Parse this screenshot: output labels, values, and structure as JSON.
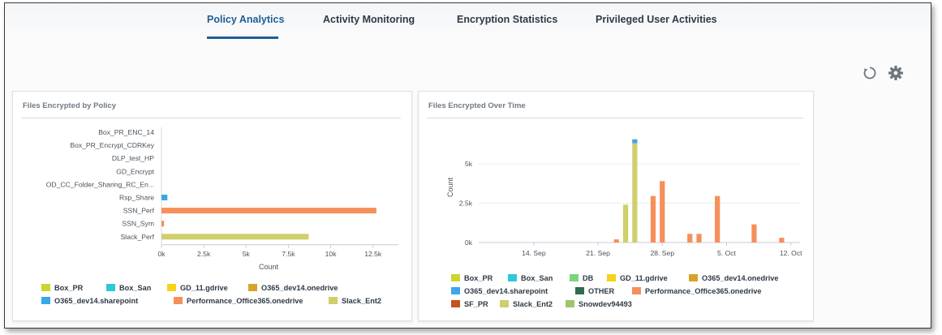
{
  "tabs": [
    {
      "label": "Policy Analytics",
      "active": true
    },
    {
      "label": "Activity Monitoring",
      "active": false
    },
    {
      "label": "Encryption Statistics",
      "active": false
    },
    {
      "label": "Privileged User Activities",
      "active": false
    }
  ],
  "toolbar": {
    "refresh_icon": "refresh-icon",
    "settings_icon": "gear-icon"
  },
  "panels": {
    "by_policy": {
      "title": "Files Encrypted by Policy"
    },
    "over_time": {
      "title": "Files Encrypted Over Time"
    }
  },
  "colors": {
    "Box_PR": "#cad62c",
    "Box_San": "#2ec8d8",
    "DB": "#7ad67a",
    "GD_11.gdrive": "#f5d21c",
    "O365_dev14.onedrive": "#d7a42a",
    "O365_dev14.sharepoint": "#3aa7e8",
    "OTHER": "#2e6b52",
    "Performance_Office365.onedrive": "#f5905a",
    "SF_PR": "#c0551e",
    "Slack_Ent2": "#cfcf6c",
    "Snowdev94493": "#9ec56e"
  },
  "chart_data": [
    {
      "type": "bar",
      "orientation": "horizontal",
      "stacked": true,
      "title": "",
      "xlabel": "Count",
      "ylabel": "",
      "xlim": [
        0,
        14000
      ],
      "xticks": [
        0,
        2500,
        5000,
        7500,
        10000,
        12500
      ],
      "xtick_labels": [
        "0k",
        "2.5k",
        "5k",
        "7.5k",
        "10k",
        "12.5k"
      ],
      "categories": [
        "Box_PR_ENC_14",
        "Box_PR_Encrypt_CDRKey",
        "DLP_test_HP",
        "GD_Encrypt",
        "OD_CC_Folder_Sharing_RC_En...",
        "Rsp_Share",
        "SSN_Perf",
        "SSN_Sym",
        "Slack_Perf"
      ],
      "series": [
        {
          "name": "O365_dev14.sharepoint",
          "values": [
            0,
            0,
            0,
            0,
            0,
            350,
            0,
            0,
            0
          ]
        },
        {
          "name": "Performance_Office365.onedrive",
          "values": [
            0,
            0,
            0,
            0,
            0,
            0,
            12700,
            150,
            0
          ]
        },
        {
          "name": "Slack_Ent2",
          "values": [
            0,
            0,
            0,
            0,
            0,
            0,
            0,
            0,
            8700
          ]
        }
      ],
      "legend": {
        "position": "bottom",
        "items": [
          "Box_PR",
          "Box_San",
          "GD_11.gdrive",
          "O365_dev14.onedrive",
          "O365_dev14.sharepoint",
          "Performance_Office365.onedrive",
          "Slack_Ent2"
        ]
      },
      "grid": false
    },
    {
      "type": "bar",
      "stacked": true,
      "title": "",
      "xlabel": "",
      "ylabel": "Count",
      "ylim": [
        0,
        7000
      ],
      "yticks": [
        0,
        2500,
        5000
      ],
      "ytick_labels": [
        "0k",
        "2.5k",
        "5k"
      ],
      "x_range": [
        "2023-09-08",
        "2023-10-13"
      ],
      "xticks": [
        "2023-09-14",
        "2023-09-21",
        "2023-09-28",
        "2023-10-05",
        "2023-10-12"
      ],
      "xtick_labels": [
        "14. Sep",
        "21. Sep",
        "28. Sep",
        "5. Oct",
        "12. Oct"
      ],
      "bars": [
        {
          "date": "2023-09-23",
          "series": "Performance_Office365.onedrive",
          "value": 200
        },
        {
          "date": "2023-09-24",
          "series": "Slack_Ent2",
          "value": 2400
        },
        {
          "date": "2023-09-25",
          "series": "Slack_Ent2",
          "value": 6300
        },
        {
          "date": "2023-09-25",
          "series": "O365_dev14.sharepoint",
          "value": 250
        },
        {
          "date": "2023-09-27",
          "series": "Performance_Office365.onedrive",
          "value": 2950
        },
        {
          "date": "2023-09-28",
          "series": "Performance_Office365.onedrive",
          "value": 3900
        },
        {
          "date": "2023-10-01",
          "series": "Performance_Office365.onedrive",
          "value": 550
        },
        {
          "date": "2023-10-02",
          "series": "Performance_Office365.onedrive",
          "value": 550
        },
        {
          "date": "2023-10-04",
          "series": "Performance_Office365.onedrive",
          "value": 2950
        },
        {
          "date": "2023-10-08",
          "series": "Performance_Office365.onedrive",
          "value": 1150
        },
        {
          "date": "2023-10-11",
          "series": "Performance_Office365.onedrive",
          "value": 300
        }
      ],
      "legend": {
        "position": "bottom",
        "items": [
          "Box_PR",
          "Box_San",
          "DB",
          "GD_11.gdrive",
          "O365_dev14.onedrive",
          "O365_dev14.sharepoint",
          "OTHER",
          "Performance_Office365.onedrive",
          "SF_PR",
          "Slack_Ent2",
          "Snowdev94493"
        ]
      },
      "grid": true
    }
  ]
}
